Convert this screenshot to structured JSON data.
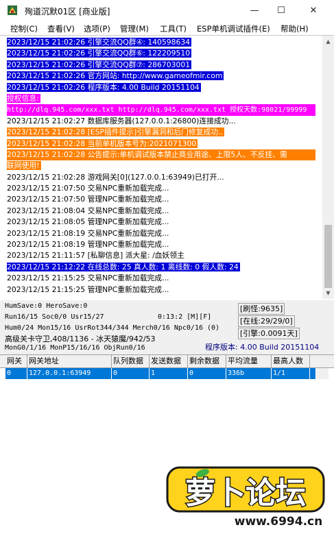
{
  "window": {
    "title": "殉道沉默01区 [商业版]",
    "minimize": "—",
    "maximize": "☐",
    "close": "✕"
  },
  "menu": [
    "控制(C)",
    "查看(V)",
    "选项(P)",
    "管理(M)",
    "工具(T)",
    "ESP单机调试插件(E)",
    "帮助(H)"
  ],
  "log": [
    {
      "text": "2023/12/15 21:02:26 引擎交流QQ群④: 140598634",
      "bg": "#0000d8",
      "fg": "#ffffff",
      "full": false
    },
    {
      "text": "2023/12/15 21:02:26 引擎交流QQ群⑥: 122209510",
      "bg": "#0000d8",
      "fg": "#ffffff",
      "full": false
    },
    {
      "text": "2023/12/15 21:02:26 引擎交流QQ群⑦: 286703001",
      "bg": "#0000d8",
      "fg": "#ffffff",
      "full": false
    },
    {
      "text": "2023/12/15 21:02:26 官方网站: http://www.gameofmir.com",
      "bg": "#0000d8",
      "fg": "#ffffff",
      "full": false
    },
    {
      "text": "2023/12/15 21:02:26 程序版本: 4.00 Build 20151104",
      "bg": "#0000d8",
      "fg": "#ffffff",
      "full": false
    },
    {
      "text": "授权信息:",
      "bg": "#ff00ff",
      "fg": "#ffffff",
      "full": false
    },
    {
      "text": "http://dlq.945.com/xxx.txt http://dlq.945.com/xxx.txt 授权天数:98021/99999",
      "bg": "#ff00ff",
      "fg": "#ffffff",
      "full": true
    },
    {
      "text": "2023/12/15 21:02:27 数据库服务器(127.0.0.1:26800)连接成功...",
      "bg": "",
      "fg": "#000000",
      "full": false
    },
    {
      "text": "2023/12/15 21:02:28 [ESP插件提示]引擎漏洞和后门修复成功..",
      "bg": "#ff8000",
      "fg": "#ffffff",
      "full": false
    },
    {
      "text": "2023/12/15 21:02:28 当前单机版本号为:2021071300",
      "bg": "#ff8000",
      "fg": "#ffffff",
      "full": false
    },
    {
      "text": "2023/12/15 21:02:28 公告提示:单机调试版本禁止商业用途、上限5人、不反挂、需",
      "bg": "#ff8000",
      "fg": "#ffffff",
      "full": true
    },
    {
      "text": "联网使用!",
      "bg": "#ff8000",
      "fg": "#ffffff",
      "full": false
    },
    {
      "text": "2023/12/15 21:02:28 游戏网关[0](127.0.0.1:63949)已打开...",
      "bg": "",
      "fg": "#000000",
      "full": false
    },
    {
      "text": "2023/12/15 21:07:50 交易NPC重新加载完成...",
      "bg": "",
      "fg": "#000000",
      "full": false
    },
    {
      "text": "2023/12/15 21:07:50 管理NPC重新加载完成...",
      "bg": "",
      "fg": "#000000",
      "full": false
    },
    {
      "text": "2023/12/15 21:08:04 交易NPC重新加载完成...",
      "bg": "",
      "fg": "#000000",
      "full": false
    },
    {
      "text": "2023/12/15 21:08:05 管理NPC重新加载完成...",
      "bg": "",
      "fg": "#000000",
      "full": false
    },
    {
      "text": "2023/12/15 21:08:19 交易NPC重新加载完成...",
      "bg": "",
      "fg": "#000000",
      "full": false
    },
    {
      "text": "2023/12/15 21:08:19 管理NPC重新加载完成...",
      "bg": "",
      "fg": "#000000",
      "full": false
    },
    {
      "text": "2023/12/15 21:11:57 [私聊信息] 派大星: /血妖领主",
      "bg": "",
      "fg": "#000000",
      "full": false
    },
    {
      "text": "2023/12/15 21:12:22 在线总数: 25 真人数: 1 离线数: 0 假人数: 24",
      "bg": "#0000d8",
      "fg": "#ffffff",
      "full": false
    },
    {
      "text": "2023/12/15 21:15:25 交易NPC重新加载完成...",
      "bg": "",
      "fg": "#000000",
      "full": false
    },
    {
      "text": "2023/12/15 21:15:25 管理NPC重新加载完成...",
      "bg": "",
      "fg": "#000000",
      "full": false
    }
  ],
  "status": {
    "line1": "HumSave:0 HeroSave:0",
    "line2a": "Run16/15 Soc0/0 Usr15/27",
    "line2b": "0:13:2 [M][F]",
    "line3": "Hum0/24 Mon15/16 UsrRot344/344 Merch0/16 Npc0/16 (0)",
    "line4": "高级关卡守卫,408/1136 - 冰天猿魔/942/53",
    "line5": "MonG0/1/16 MonP15/16/16 ObjRun0/16",
    "refresh": "[刷怪:9635]",
    "online": "[在线:29/29/0]",
    "engine": "[引擎:0.0091天]",
    "version": "程序版本: 4.00 Build 20151104",
    "version_color": "#000080"
  },
  "table": {
    "headers": [
      "网关",
      "网关地址",
      "队列数据",
      "发送数据",
      "剩余数据",
      "平均流量",
      "最高人数"
    ],
    "rows": [
      [
        "0",
        "127.0.0.1:63949",
        "0",
        "1",
        "0",
        "336b",
        "1/1"
      ]
    ]
  },
  "watermark": {
    "brand": "萝卜论坛",
    "url": "www.6994.cn"
  }
}
